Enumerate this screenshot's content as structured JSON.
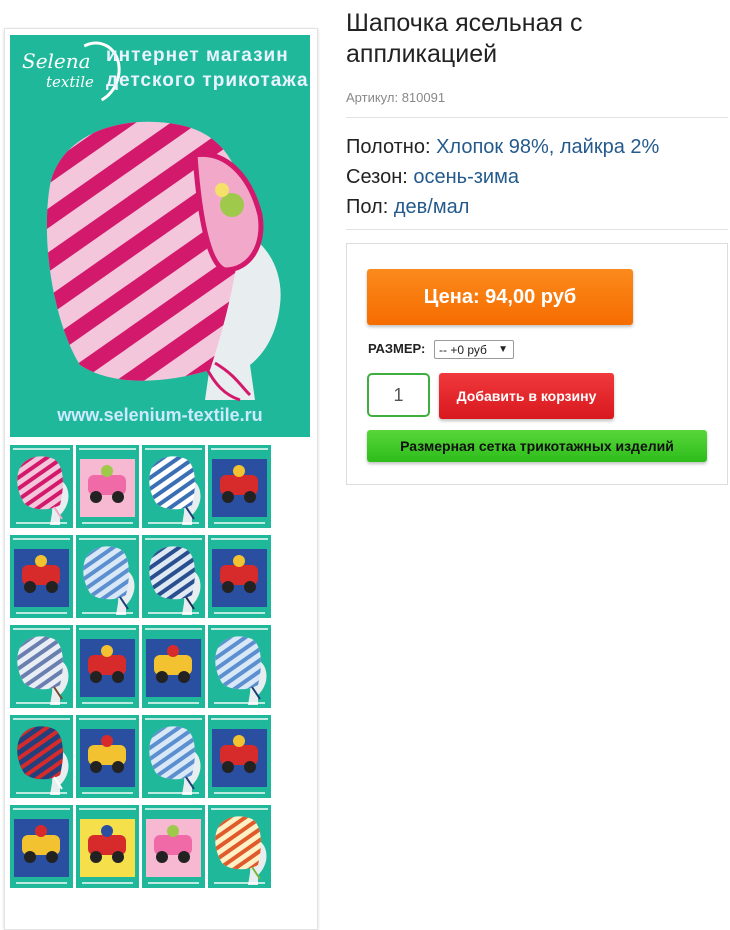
{
  "product": {
    "title": "Шапочка ясельная с аппликацией",
    "sku_label": "Артикул:",
    "sku_value": "810091"
  },
  "properties": [
    {
      "label": "Полотно:",
      "value": "Хлопок 98%, лайкра 2%"
    },
    {
      "label": "Сезон:",
      "value": "осень-зима"
    },
    {
      "label": "Пол:",
      "value": "дев/мал"
    }
  ],
  "buy": {
    "price_label": "Цена: 94,00 руб",
    "size_label": "РАЗМЕР:",
    "size_selected": "-- +0 руб",
    "quantity": "1",
    "add_to_cart": "Добавить в корзину",
    "size_chart": "Размерная сетка трикотажных изделий"
  },
  "main_image": {
    "logo_line1": "Selena",
    "logo_line2": "textile",
    "heading_line1": "интернет магазин",
    "heading_line2": "детского трикотажа",
    "url": "www.selenium-textile.ru"
  },
  "colors": {
    "teal_bg": "#20b89a",
    "price_orange": "#f77a0c",
    "cart_red": "#e2282c",
    "size_green": "#3fc727",
    "prop_blue": "#245a8c"
  },
  "thumbnails": [
    {
      "kind": "pink-stripe-hat"
    },
    {
      "kind": "pink-applique"
    },
    {
      "kind": "blue-stripe-hat-white"
    },
    {
      "kind": "car-applique"
    },
    {
      "kind": "car-applique"
    },
    {
      "kind": "blue-stripe-hat"
    },
    {
      "kind": "navy-stripe-hat"
    },
    {
      "kind": "car-applique"
    },
    {
      "kind": "brown-stripe-hat"
    },
    {
      "kind": "car-applique"
    },
    {
      "kind": "cartoon-applique"
    },
    {
      "kind": "blue-stripe-hat"
    },
    {
      "kind": "navy-hat-car"
    },
    {
      "kind": "cartoon-applique"
    },
    {
      "kind": "blue-stripe-hat"
    },
    {
      "kind": "car-applique"
    },
    {
      "kind": "cartoon-applique"
    },
    {
      "kind": "yellow-cartoon"
    },
    {
      "kind": "pink-applique"
    },
    {
      "kind": "multicolor-stripe-hat"
    }
  ]
}
